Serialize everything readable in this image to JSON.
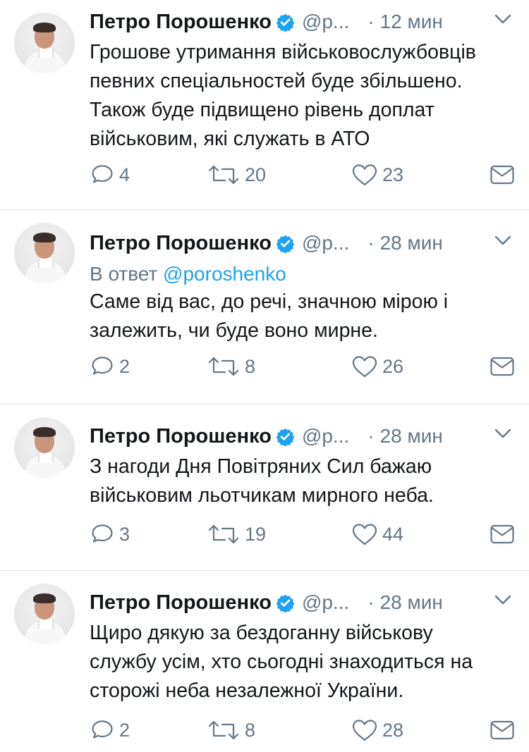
{
  "tweets": [
    {
      "author": "Петро Порошенко",
      "handle": "@p...",
      "dot": "·",
      "time": "12 мин",
      "reply_prefix": "",
      "reply_mention": "",
      "text_lines": [
        "Грошове утримання військовослужбовців",
        "певних спеціальностей буде збільшено.",
        "Також буде підвищено рівень доплат",
        "військовим, які служать в АТО"
      ],
      "replies": "4",
      "retweets": "20",
      "likes": "23"
    },
    {
      "author": "Петро Порошенко",
      "handle": "@p...",
      "dot": "·",
      "time": "28 мин",
      "reply_prefix": "В ответ ",
      "reply_mention": "@poroshenko",
      "text_lines": [
        "Саме від вас, до речі, значною мірою і",
        "залежить, чи буде воно мирне."
      ],
      "replies": "2",
      "retweets": "8",
      "likes": "26"
    },
    {
      "author": "Петро Порошенко",
      "handle": "@p...",
      "dot": "·",
      "time": "28 мин",
      "reply_prefix": "",
      "reply_mention": "",
      "text_lines": [
        "З нагоди Дня Повітряних Сил бажаю",
        "військовим льотчикам мирного неба."
      ],
      "replies": "3",
      "retweets": "19",
      "likes": "44"
    },
    {
      "author": "Петро Порошенко",
      "handle": "@p...",
      "dot": "·",
      "time": "28 мин",
      "reply_prefix": "",
      "reply_mention": "",
      "text_lines": [
        "Щиро дякую за бездоганну військову",
        "службу усім, хто сьогодні знаходиться на",
        "сторожі неба незалежної України."
      ],
      "replies": "2",
      "retweets": "8",
      "likes": "28"
    }
  ],
  "colors": {
    "verified": "#1da1f2",
    "mention": "#1da1f2",
    "meta": "#657786",
    "divider": "#dfe3e6"
  },
  "icons": [
    "verified-badge-icon",
    "chevron-down-icon",
    "reply-icon",
    "retweet-icon",
    "like-heart-icon",
    "direct-message-icon"
  ]
}
